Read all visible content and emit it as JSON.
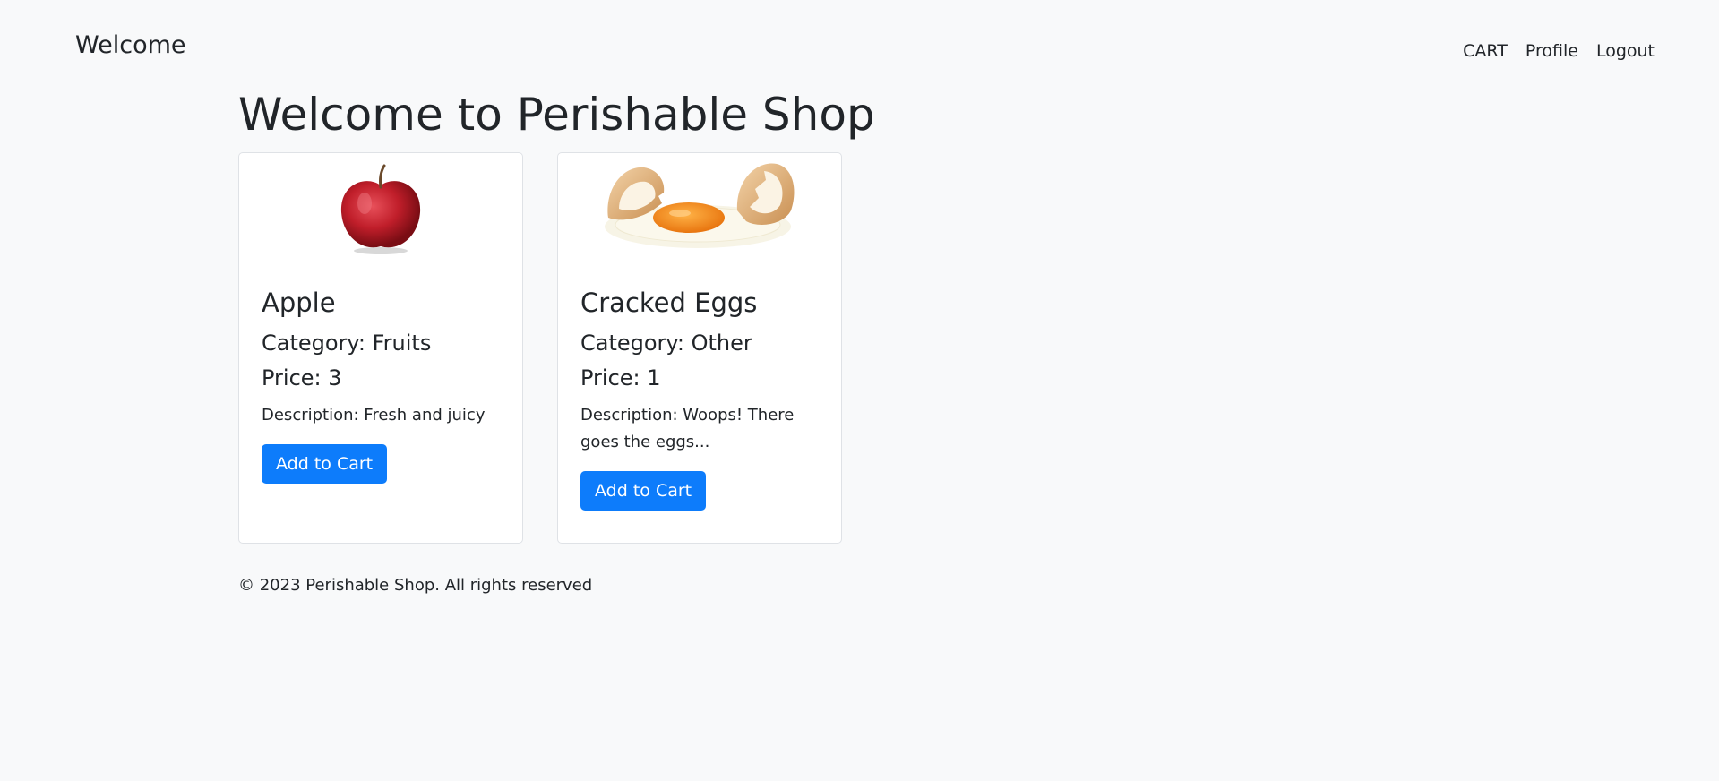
{
  "navbar": {
    "brand": "Welcome",
    "links": [
      "CART",
      "Profile",
      "Logout"
    ]
  },
  "page": {
    "title": "Welcome to Perishable Shop"
  },
  "products": [
    {
      "image_icon": "apple-image",
      "name": "Apple",
      "category": "Category: Fruits",
      "price": "Price: 3",
      "description": "Description: Fresh and juicy",
      "button_label": "Add to Cart"
    },
    {
      "image_icon": "cracked-eggs-image",
      "name": "Cracked Eggs",
      "category": "Category: Other",
      "price": "Price: 1",
      "description": "Description: Woops! There goes the eggs...",
      "button_label": "Add to Cart"
    }
  ],
  "footer": {
    "text": "© 2023 Perishable Shop. All rights reserved"
  },
  "colors": {
    "background": "#f8f9fa",
    "primary_button": "#0d7cfb",
    "text": "#212529",
    "card_border": "#dfe2e6"
  }
}
